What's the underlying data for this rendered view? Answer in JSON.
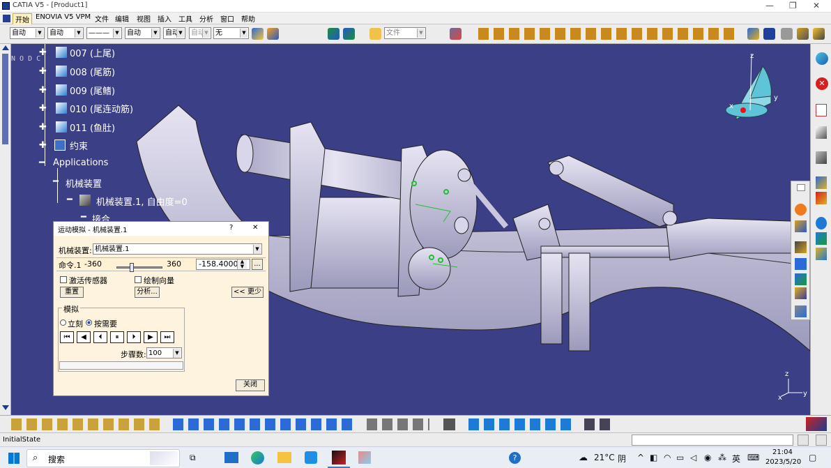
{
  "window": {
    "title": "CATIA V5 - [Product1]"
  },
  "menu": [
    "开始",
    "ENOVIA V5 VPM",
    "文件",
    "编辑",
    "视图",
    "插入",
    "工具",
    "分析",
    "窗口",
    "帮助"
  ],
  "toolbar": {
    "combo1": "自动",
    "combo2": "自动",
    "combo3": "———",
    "combo4": "自动",
    "combo5": "自动",
    "combo6": "自动",
    "combo7": "无",
    "file_combo": "文件"
  },
  "viewport": {
    "nodc": "N O D C",
    "axis_z": "z",
    "axis_y": "y",
    "axis_x": "x",
    "small_z": "z",
    "small_y": "y",
    "small_x": "x"
  },
  "tree": {
    "items": [
      "007 (上尾)",
      "008 (尾筋)",
      "009 (尾鳍)",
      "010 (尾连动筋)",
      "011 (鱼肚)",
      "约束",
      "Applications",
      "机械装置",
      "机械装置.1, 自由度=0",
      "接合"
    ]
  },
  "dialog": {
    "title": "运动模拟 - 机械装置.1",
    "help": "?",
    "close_x": "✕",
    "mech_label": "机械装置:",
    "mech_value": "机械装置.1",
    "cmd_label": "命令.1",
    "min": "-360",
    "max": "360",
    "value": "-158.4000",
    "slider_fraction": 0.31,
    "more_btn": "...",
    "activate_sensors": "激活传感器",
    "plot_vectors": "绘制向量",
    "reset": "重置",
    "analyze": "分析...",
    "less": "<< 更少",
    "sim_group": "模拟",
    "immediate": "立刻",
    "on_request": "按需要",
    "steps_label": "步骤数:",
    "steps_value": "100",
    "close": "关闭"
  },
  "status": {
    "text": "InitialState"
  },
  "taskbar": {
    "search": "搜索",
    "weather_temp": "21°C",
    "weather_desc": "阴",
    "lang": "英",
    "time": "21:04",
    "date": "2023/5/20"
  },
  "colors": {
    "viewport": "#3b3f86",
    "catia_accent": "#c7a84c"
  }
}
